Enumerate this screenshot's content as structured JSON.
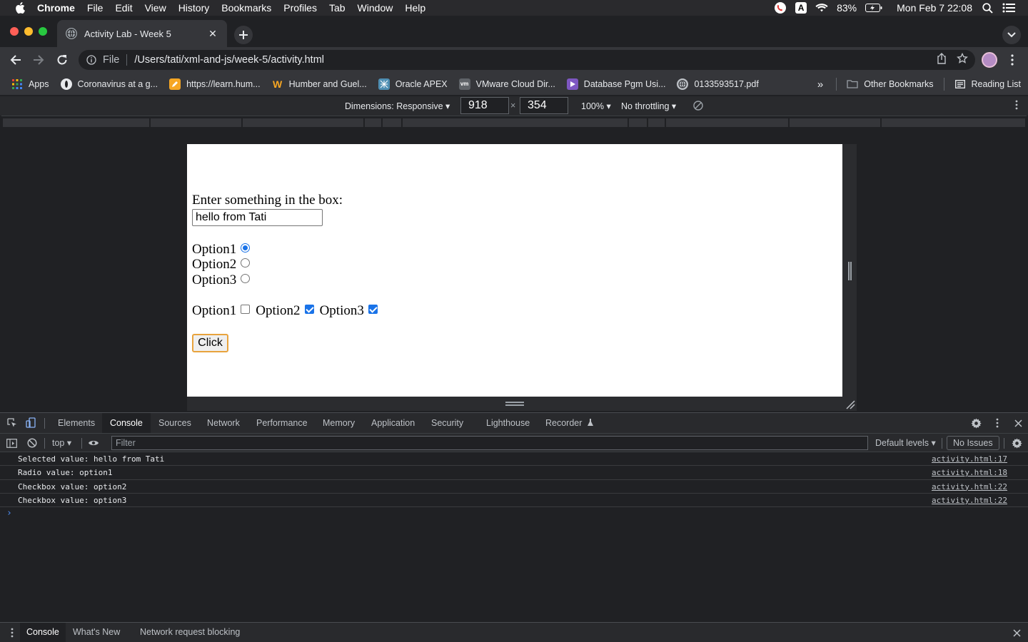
{
  "menubar": {
    "app": "Chrome",
    "items": [
      "File",
      "Edit",
      "View",
      "History",
      "Bookmarks",
      "Profiles",
      "Tab",
      "Window",
      "Help"
    ],
    "input_source": "A",
    "battery": "83%",
    "clock": "Mon Feb 7  22:08"
  },
  "tab": {
    "title": "Activity Lab - Week 5"
  },
  "omnibox": {
    "scheme": "File",
    "url": "/Users/tati/xml-and-js/week-5/activity.html"
  },
  "bookmarks": {
    "items": [
      {
        "label": "Apps",
        "icon": "apps-grid-icon"
      },
      {
        "label": "Coronavirus at a g...",
        "icon": "site-icon"
      },
      {
        "label": "https://learn.hum...",
        "icon": "pencil-site-icon"
      },
      {
        "label": "Humber and Guel...",
        "icon": "w-logo-icon"
      },
      {
        "label": "Oracle APEX",
        "icon": "apex-icon"
      },
      {
        "label": "VMware Cloud Dir...",
        "icon": "vm-icon"
      },
      {
        "label": "Database Pgm Usi...",
        "icon": "play-icon"
      },
      {
        "label": "0133593517.pdf",
        "icon": "globe-icon"
      }
    ],
    "overflow": "»",
    "other": "Other Bookmarks",
    "reading_list": "Reading List"
  },
  "device_toolbar": {
    "dimensions": "Dimensions: Responsive ▾",
    "width": "918",
    "times": "×",
    "height": "354",
    "zoom": "100% ▾",
    "throttling": "No throttling ▾"
  },
  "page": {
    "prompt_label": "Enter something in the box:",
    "input_value": "hello from Tati",
    "radios": [
      {
        "label": "Option1",
        "checked": true
      },
      {
        "label": "Option2",
        "checked": false
      },
      {
        "label": "Option3",
        "checked": false
      }
    ],
    "checkboxes": [
      {
        "label": "Option1",
        "checked": false
      },
      {
        "label": "Option2",
        "checked": true
      },
      {
        "label": "Option3",
        "checked": true
      }
    ],
    "button_label": "Click"
  },
  "devtools": {
    "tabs": [
      "Elements",
      "Console",
      "Sources",
      "Network",
      "Performance",
      "Memory",
      "Application",
      "Security",
      "Lighthouse",
      "Recorder"
    ],
    "active_tab": "Console",
    "context": "top ▾",
    "filter_placeholder": "Filter",
    "levels": "Default levels ▾",
    "issues": "No Issues",
    "logs": [
      {
        "text": "Selected value: hello from Tati",
        "source": "activity.html:17"
      },
      {
        "text": "Radio value: option1",
        "source": "activity.html:18"
      },
      {
        "text": "Checkbox value: option2",
        "source": "activity.html:22"
      },
      {
        "text": "Checkbox value: option3",
        "source": "activity.html:22"
      }
    ],
    "prompt": "›",
    "drawer_tabs": [
      "Console",
      "What's New",
      "Network request blocking"
    ]
  },
  "colors": {
    "traffic_red": "#ff5f57",
    "traffic_yellow": "#febc2e",
    "traffic_green": "#28c840",
    "accent_blue": "#1a73e8",
    "focus_orange": "#e8a33d"
  }
}
